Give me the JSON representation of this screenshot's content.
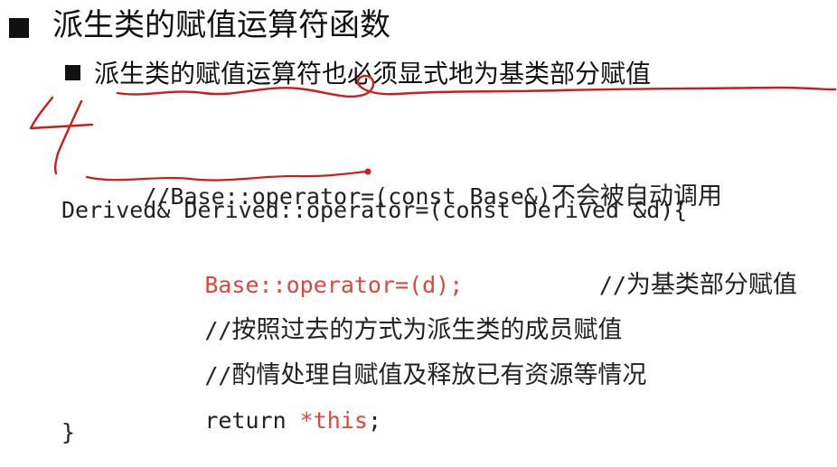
{
  "slide": {
    "heading": "派生类的赋值运算符函数",
    "subheading": "派生类的赋值运算符也必须显式地为基类部分赋值",
    "handwritten_mark": "4",
    "code": {
      "line1_code": "//Base::operator=(const Base&)",
      "line1_comment": "不会被自动调用",
      "line2": "Derived& Derived::operator=(const Derived &d){",
      "line3_code": "Base::operator=(d);",
      "line3_comment_slashes": "//",
      "line3_comment": "为基类部分赋值",
      "line4_slashes": "//",
      "line4_text": "按照过去的方式为派生类的成员赋值",
      "line5_slashes": "//",
      "line5_text": "酌情处理自赋值及释放已有资源等情况",
      "line6_kw": "return ",
      "line6_expr": "*this",
      "line6_end": ";",
      "line7": "}"
    }
  },
  "colors": {
    "accent_red": "#d9473d",
    "ink_red": "#cc1c1c",
    "text": "#222222"
  }
}
